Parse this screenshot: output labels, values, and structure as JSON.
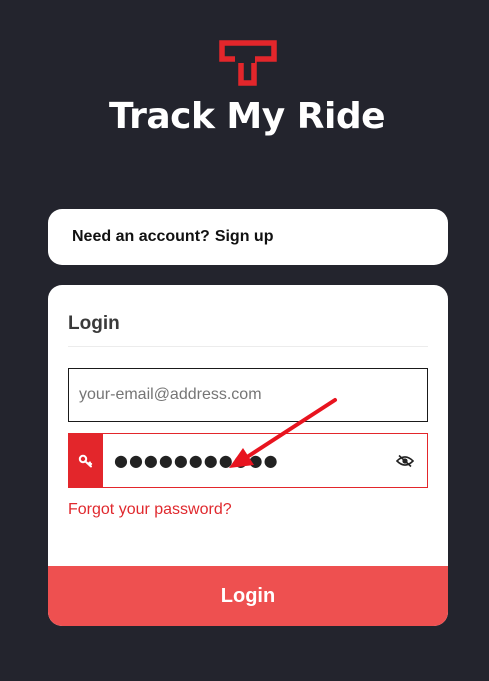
{
  "brand": {
    "name": "Track My Ride",
    "accent_color": "#e3262b",
    "logo_icon": "tmr-logo-icon"
  },
  "signup": {
    "prompt": "Need an account?",
    "link_label": "Sign up"
  },
  "login": {
    "heading": "Login",
    "email_field": {
      "placeholder": "your-email@address.com",
      "value": ""
    },
    "password_field": {
      "masked_value": "●●●●●●●●●●●",
      "icon": "key-icon",
      "toggle_icon": "eye-slash-icon"
    },
    "forgot_label": "Forgot your password?",
    "submit_label": "Login",
    "submit_color": "#ee5050"
  },
  "annotation": {
    "icon": "red-arrow-icon",
    "color": "#e8141f"
  }
}
